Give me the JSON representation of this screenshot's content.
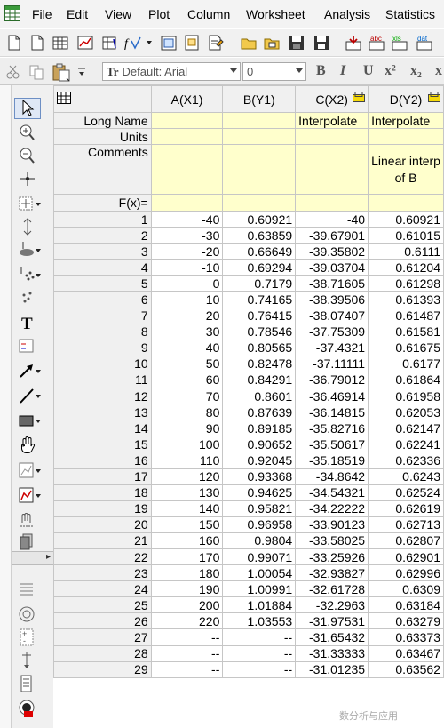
{
  "menu": {
    "items": [
      "File",
      "Edit",
      "View",
      "Plot",
      "Column",
      "Worksheet",
      "Analysis",
      "Statistics"
    ]
  },
  "toolbar": {
    "font_combo": "Default: Arial",
    "size_combo": "0",
    "format_buttons": [
      "B",
      "I",
      "U",
      "x²",
      "x₂",
      "x"
    ]
  },
  "tools": [
    "arrow-pointer",
    "zoom-in",
    "zoom-out",
    "crosshair",
    "scale",
    "screen-reader",
    "data-reader",
    "data-selector",
    "region-mask",
    "text",
    "legend",
    "arrow",
    "line",
    "rectangle",
    "pan-hand",
    "graph",
    "layout",
    "move",
    "pin"
  ],
  "worksheet": {
    "corner_icon": "worksheet-grid-icon",
    "columns": [
      {
        "header": "A(X1)",
        "long_name": "",
        "units": "",
        "comments": ""
      },
      {
        "header": "B(Y1)",
        "long_name": "",
        "units": "",
        "comments": ""
      },
      {
        "header": "C(X2)",
        "long_name": "Interpolate",
        "units": "",
        "comments": ""
      },
      {
        "header": "D(Y2)",
        "long_name": "Interpolate",
        "units": "",
        "comments": "Linear interp of B"
      }
    ],
    "meta_labels": {
      "long_name": "Long Name",
      "units": "Units",
      "comments": "Comments",
      "fx": "F(x)="
    },
    "rows": [
      {
        "n": "1",
        "a": "-40",
        "b": "0.60921",
        "c": "-40",
        "d": "0.60921"
      },
      {
        "n": "2",
        "a": "-30",
        "b": "0.63859",
        "c": "-39.67901",
        "d": "0.61015"
      },
      {
        "n": "3",
        "a": "-20",
        "b": "0.66649",
        "c": "-39.35802",
        "d": "0.6111"
      },
      {
        "n": "4",
        "a": "-10",
        "b": "0.69294",
        "c": "-39.03704",
        "d": "0.61204"
      },
      {
        "n": "5",
        "a": "0",
        "b": "0.7179",
        "c": "-38.71605",
        "d": "0.61298"
      },
      {
        "n": "6",
        "a": "10",
        "b": "0.74165",
        "c": "-38.39506",
        "d": "0.61393"
      },
      {
        "n": "7",
        "a": "20",
        "b": "0.76415",
        "c": "-38.07407",
        "d": "0.61487"
      },
      {
        "n": "8",
        "a": "30",
        "b": "0.78546",
        "c": "-37.75309",
        "d": "0.61581"
      },
      {
        "n": "9",
        "a": "40",
        "b": "0.80565",
        "c": "-37.4321",
        "d": "0.61675"
      },
      {
        "n": "10",
        "a": "50",
        "b": "0.82478",
        "c": "-37.11111",
        "d": "0.6177"
      },
      {
        "n": "11",
        "a": "60",
        "b": "0.84291",
        "c": "-36.79012",
        "d": "0.61864"
      },
      {
        "n": "12",
        "a": "70",
        "b": "0.8601",
        "c": "-36.46914",
        "d": "0.61958"
      },
      {
        "n": "13",
        "a": "80",
        "b": "0.87639",
        "c": "-36.14815",
        "d": "0.62053"
      },
      {
        "n": "14",
        "a": "90",
        "b": "0.89185",
        "c": "-35.82716",
        "d": "0.62147"
      },
      {
        "n": "15",
        "a": "100",
        "b": "0.90652",
        "c": "-35.50617",
        "d": "0.62241"
      },
      {
        "n": "16",
        "a": "110",
        "b": "0.92045",
        "c": "-35.18519",
        "d": "0.62336"
      },
      {
        "n": "17",
        "a": "120",
        "b": "0.93368",
        "c": "-34.8642",
        "d": "0.6243"
      },
      {
        "n": "18",
        "a": "130",
        "b": "0.94625",
        "c": "-34.54321",
        "d": "0.62524"
      },
      {
        "n": "19",
        "a": "140",
        "b": "0.95821",
        "c": "-34.22222",
        "d": "0.62619"
      },
      {
        "n": "20",
        "a": "150",
        "b": "0.96958",
        "c": "-33.90123",
        "d": "0.62713"
      },
      {
        "n": "21",
        "a": "160",
        "b": "0.9804",
        "c": "-33.58025",
        "d": "0.62807"
      },
      {
        "n": "22",
        "a": "170",
        "b": "0.99071",
        "c": "-33.25926",
        "d": "0.62901"
      },
      {
        "n": "23",
        "a": "180",
        "b": "1.00054",
        "c": "-32.93827",
        "d": "0.62996"
      },
      {
        "n": "24",
        "a": "190",
        "b": "1.00991",
        "c": "-32.61728",
        "d": "0.6309"
      },
      {
        "n": "25",
        "a": "200",
        "b": "1.01884",
        "c": "-32.2963",
        "d": "0.63184"
      },
      {
        "n": "26",
        "a": "220",
        "b": "1.03553",
        "c": "-31.97531",
        "d": "0.63279"
      },
      {
        "n": "27",
        "a": "--",
        "b": "--",
        "c": "-31.65432",
        "d": "0.63373"
      },
      {
        "n": "28",
        "a": "--",
        "b": "--",
        "c": "-31.33333",
        "d": "0.63467"
      },
      {
        "n": "29",
        "a": "--",
        "b": "--",
        "c": "-31.01235",
        "d": "0.63562"
      }
    ]
  },
  "watermark": "数分析与应用",
  "colors": {
    "meta_bg": "#ffffcc",
    "header_bg": "#f0f0f0",
    "grid_line": "#c6c6c6"
  }
}
